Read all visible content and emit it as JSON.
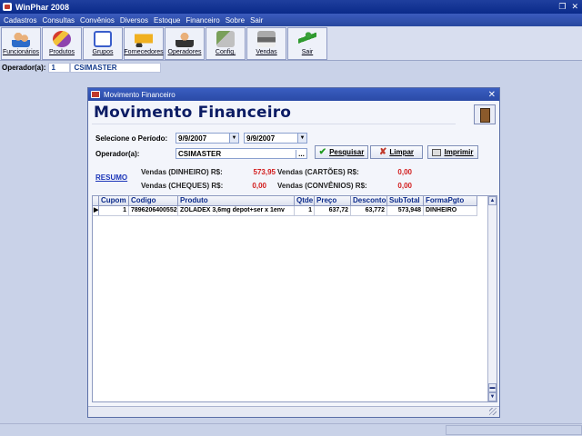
{
  "app": {
    "title": "WinPhar 2008"
  },
  "menu": [
    "Cadastros",
    "Consultas",
    "Convênios",
    "Diversos",
    "Estoque",
    "Financeiro",
    "Sobre",
    "Sair"
  ],
  "toolbar": [
    {
      "label": "Funcionários",
      "icon": "people-icon"
    },
    {
      "label": "Produtos",
      "icon": "pills-icon"
    },
    {
      "label": "Grupos",
      "icon": "window-icon"
    },
    {
      "label": "Fornecedores",
      "icon": "truck-icon"
    },
    {
      "label": "Operadores",
      "icon": "operator-icon"
    },
    {
      "label": "Config.",
      "icon": "config-icon"
    },
    {
      "label": "Vendas",
      "icon": "register-icon"
    },
    {
      "label": "Sair",
      "icon": "running-man-icon"
    }
  ],
  "operator_bar": {
    "label": "Operador(a):",
    "id": "1",
    "name": "CSIMASTER"
  },
  "dialog": {
    "title": "Movimento Financeiro",
    "heading": "Movimento Financeiro",
    "period_label": "Selecione o Período:",
    "date_from": "9/9/2007",
    "date_to": "9/9/2007",
    "operator_label": "Operador(a):",
    "operator_value": "CSIMASTER",
    "ellipsis": "...",
    "buttons": {
      "search": "Pesquisar",
      "clear": "Limpar",
      "print": "Imprimir"
    },
    "resumo": "RESUMO",
    "summary": {
      "cash_label": "Vendas (DINHEIRO) R$:",
      "cash_value": "573,95",
      "cards_label": "Vendas (CARTÕES) R$:",
      "cards_value": "0,00",
      "checks_label": "Vendas (CHEQUES) R$:",
      "checks_value": "0,00",
      "agreements_label": "Vendas (CONVÊNIOS) R$:",
      "agreements_value": "0,00"
    },
    "grid": {
      "columns": [
        "Cupom",
        "Codigo",
        "Produto",
        "Qtde",
        "Preço",
        "Desconto",
        "SubTotal",
        "FormaPgto"
      ],
      "rows": [
        {
          "cupom": "1",
          "codigo": "7896206400552",
          "produto": "ZOLADEX 3,6mg depot+ser x 1env",
          "qtde": "1",
          "preco": "637,72",
          "desconto": "63,772",
          "subtotal": "573,948",
          "forma": "DINHEIRO"
        }
      ]
    }
  }
}
